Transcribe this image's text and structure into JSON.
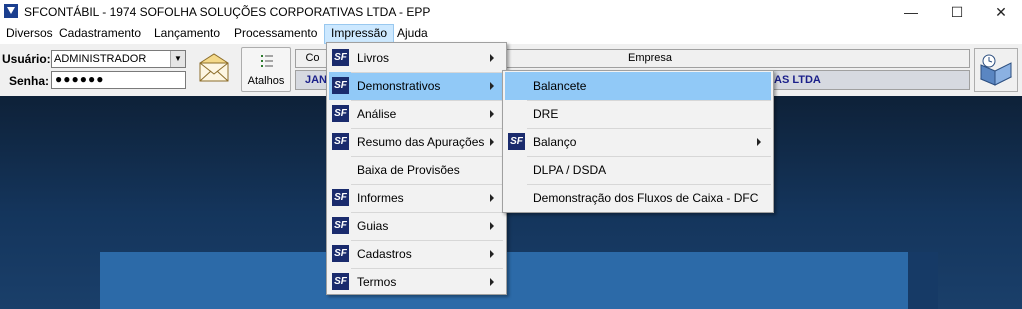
{
  "window": {
    "title": "SFCONTÁBIL - 1974 SOFOLHA SOLUÇÕES CORPORATIVAS LTDA - EPP",
    "minimize_glyph": "—",
    "maximize_glyph": "☐",
    "close_glyph": "✕"
  },
  "menubar": {
    "items": [
      {
        "label": "Diversos"
      },
      {
        "label": "Cadastramento"
      },
      {
        "label": "Lançamento"
      },
      {
        "label": "Processamento"
      },
      {
        "label": "Impressão"
      },
      {
        "label": "Ajuda"
      }
    ],
    "active_item": "Impressão"
  },
  "toolbar": {
    "usuario_label": "Usuário:",
    "usuario_value": "ADMINISTRADOR",
    "senha_label": "Senha:",
    "senha_value": "●●●●●●",
    "atalhos_label": "Atalhos",
    "co_header": "Co",
    "empresa_header": "Empresa",
    "company_left_fragment": "JAN",
    "company_right_fragment": "AS LTDA"
  },
  "impressao_menu": {
    "items": [
      {
        "label": "Livros",
        "icon": "sf-logo-icon",
        "submenu": true
      },
      {
        "label": "Demonstrativos",
        "icon": "sf-logo-icon",
        "submenu": true,
        "highlighted": true
      },
      {
        "label": "Análise",
        "icon": "sf-logo-icon",
        "submenu": true
      },
      {
        "label": "Resumo das Apurações",
        "icon": "sf-logo-icon",
        "submenu": true
      },
      {
        "label": "Baixa de Provisões",
        "icon": null,
        "submenu": false
      },
      {
        "label": "Informes",
        "icon": "sf-logo-icon",
        "submenu": true
      },
      {
        "label": "Guias",
        "icon": "sf-logo-icon",
        "submenu": true
      },
      {
        "label": "Cadastros",
        "icon": "sf-logo-icon",
        "submenu": true
      },
      {
        "label": "Termos",
        "icon": "sf-logo-icon",
        "submenu": true
      }
    ]
  },
  "demonstrativos_submenu": {
    "items": [
      {
        "label": "Balancete",
        "highlighted": true,
        "submenu": false
      },
      {
        "label": "DRE",
        "submenu": false
      },
      {
        "label": "Balanço",
        "icon": "sf-logo-icon",
        "submenu": true
      },
      {
        "label": "DLPA / DSDA",
        "submenu": false
      },
      {
        "label": "Demonstração dos Fluxos de Caixa - DFC",
        "submenu": false
      }
    ]
  },
  "icons": {
    "sf_logo_text": "SF",
    "combo_arrow": "▼"
  },
  "colors": {
    "menu_highlight": "#91c9f7",
    "sf_icon_bg": "#1a2b6d",
    "company_text": "#1a1f8a",
    "workarea_bg": "#14355c"
  }
}
